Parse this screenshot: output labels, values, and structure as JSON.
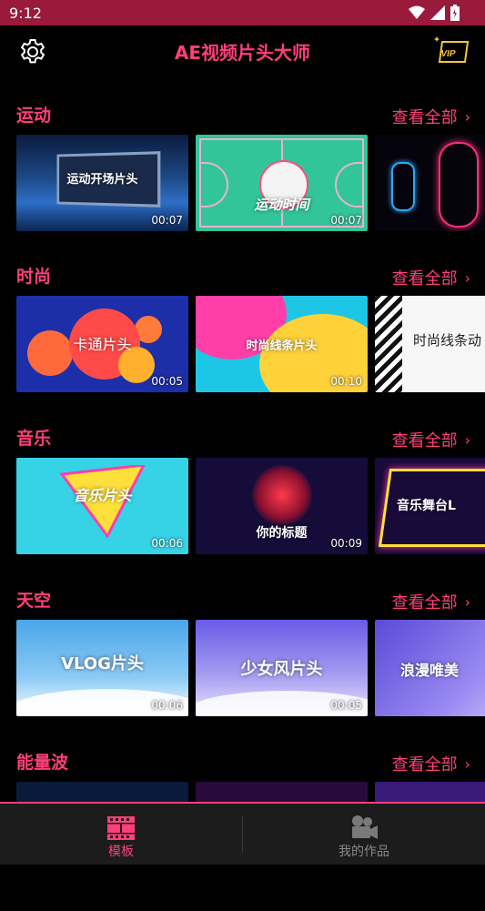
{
  "status": {
    "time": "9:12"
  },
  "app": {
    "title": "AE视频片头大师"
  },
  "sections": [
    {
      "title": "运动",
      "see_all": "查看全部",
      "cards": [
        {
          "label": "运动开场片头",
          "duration": "00:07"
        },
        {
          "label": "运动时间",
          "duration": "00:07"
        },
        {
          "label": "",
          "duration": ""
        }
      ]
    },
    {
      "title": "时尚",
      "see_all": "查看全部",
      "cards": [
        {
          "label": "卡通片头",
          "duration": "00:05"
        },
        {
          "label": "时尚线条片头",
          "duration": "00:10"
        },
        {
          "label": "时尚线条动",
          "duration": ""
        }
      ]
    },
    {
      "title": "音乐",
      "see_all": "查看全部",
      "cards": [
        {
          "label": "音乐片头",
          "duration": "00:06"
        },
        {
          "label": "你的标题",
          "duration": "00:09"
        },
        {
          "label": "音乐舞台L",
          "duration": ""
        }
      ]
    },
    {
      "title": "天空",
      "see_all": "查看全部",
      "cards": [
        {
          "label": "VLOG片头",
          "duration": "00:06"
        },
        {
          "label": "少女风片头",
          "duration": "00:05"
        },
        {
          "label": "浪漫唯美",
          "duration": ""
        }
      ]
    },
    {
      "title": "能量波",
      "see_all": "查看全部",
      "cards": []
    }
  ],
  "nav": {
    "templates": "模板",
    "my_works": "我的作品"
  },
  "colors": {
    "accent": "#ff3f7a",
    "status_bar": "#9a1a3c"
  }
}
